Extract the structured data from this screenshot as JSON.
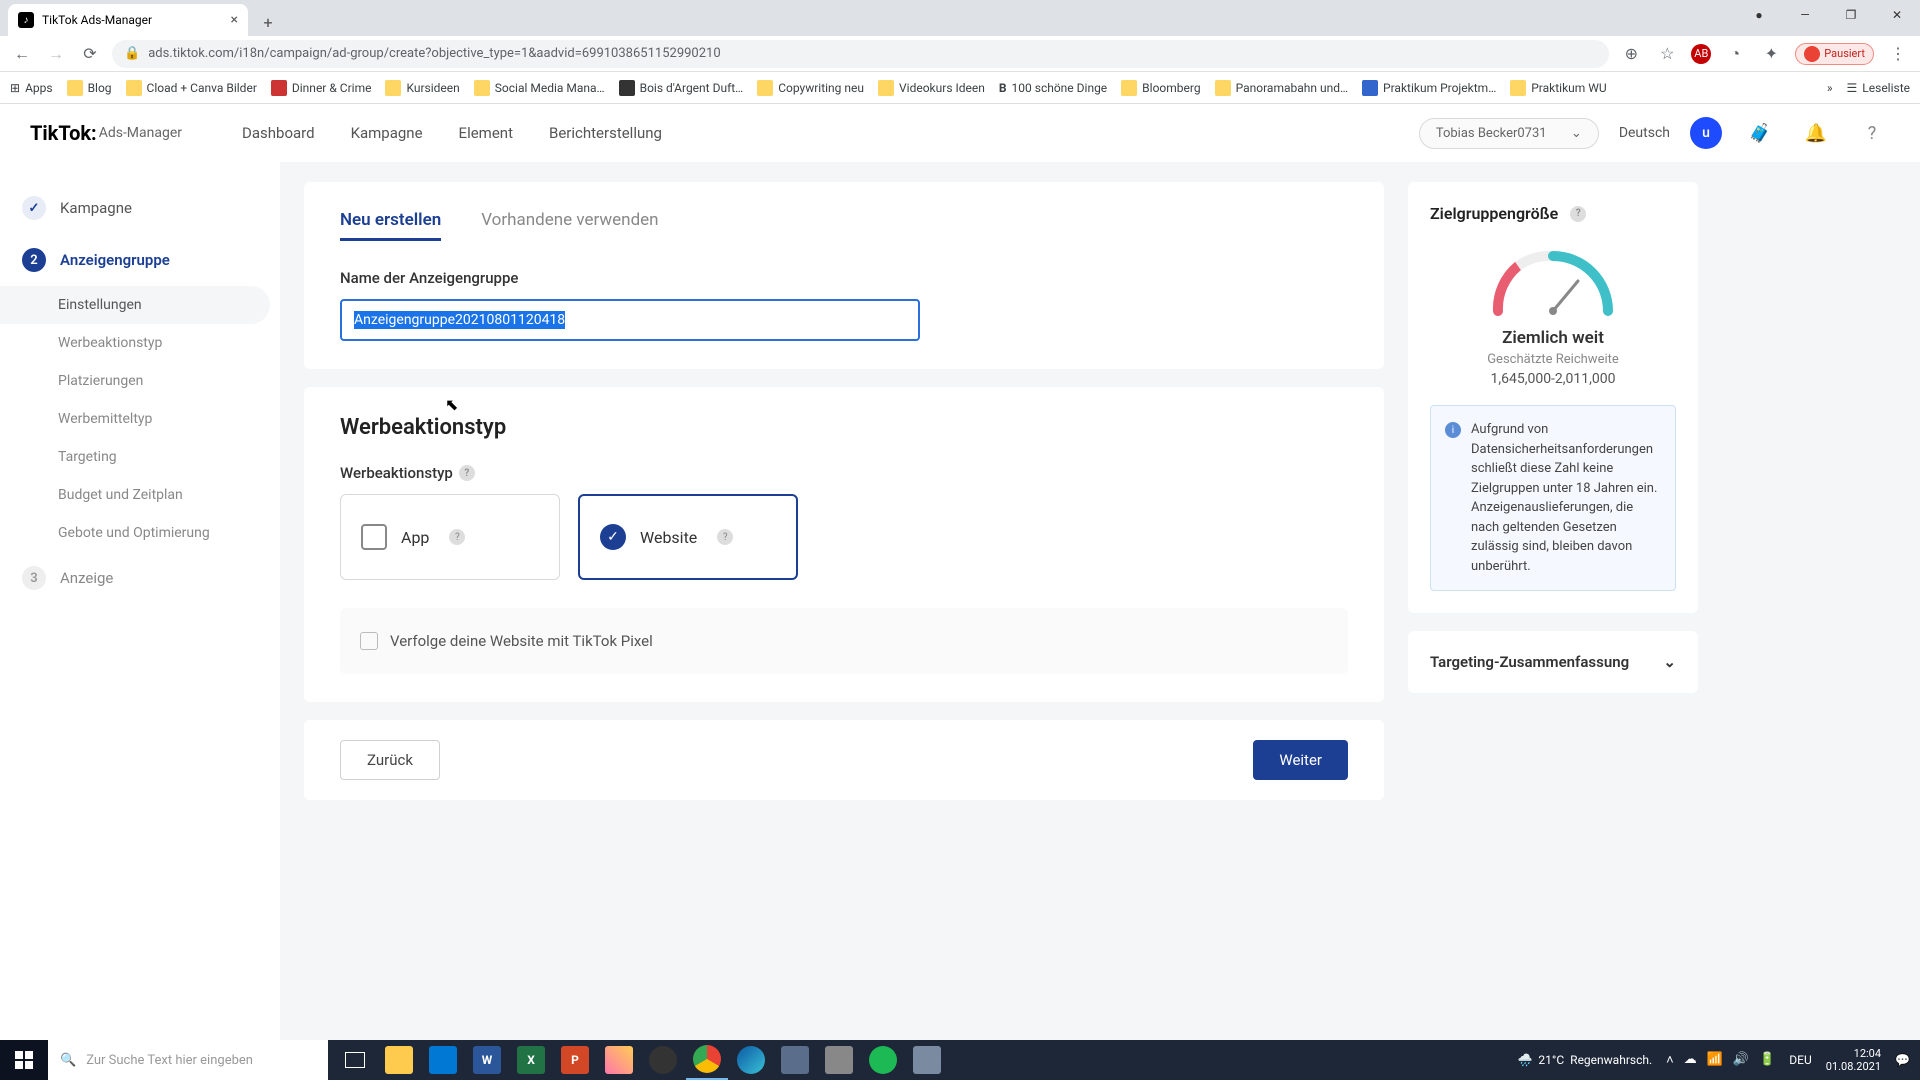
{
  "browser": {
    "tab_title": "TikTok Ads-Manager",
    "url": "ads.tiktok.com/i18n/campaign/ad-group/create?objective_type=1&aadvid=6991038651152990210",
    "pause_label": "Pausiert",
    "bookmarks": [
      "Apps",
      "Blog",
      "Cload + Canva Bilder",
      "Dinner & Crime",
      "Kursideen",
      "Social Media Mana…",
      "Bois d'Argent Duft…",
      "Copywriting neu",
      "Videokurs Ideen",
      "100 schöne Dinge",
      "Bloomberg",
      "Panoramabahn und…",
      "Praktikum Projektm…",
      "Praktikum WU"
    ],
    "reading_list": "Leseliste"
  },
  "header": {
    "logo_main": "TikTok:",
    "logo_sub": "Ads-Manager",
    "nav": [
      "Dashboard",
      "Kampagne",
      "Element",
      "Berichterstellung"
    ],
    "account": "Tobias Becker0731",
    "lang": "Deutsch",
    "avatar_letter": "u"
  },
  "sidebar": {
    "steps": [
      {
        "label": "Kampagne",
        "state": "done"
      },
      {
        "label": "Anzeigengruppe",
        "state": "active",
        "subs": [
          "Einstellungen",
          "Werbeaktionstyp",
          "Platzierungen",
          "Werbemitteltyp",
          "Targeting",
          "Budget und Zeitplan",
          "Gebote und Optimierung"
        ]
      },
      {
        "label": "Anzeige",
        "state": "pending",
        "num": "3"
      }
    ]
  },
  "main": {
    "tabs": {
      "new": "Neu erstellen",
      "existing": "Vorhandene verwenden"
    },
    "name_label": "Name der Anzeigengruppe",
    "name_value": "Anzeigengruppe20210801120418",
    "promo_section": "Werbeaktionstyp",
    "promo_label": "Werbeaktionstyp",
    "options": {
      "app": "App",
      "website": "Website"
    },
    "pixel_checkbox": "Verfolge deine Website mit TikTok Pixel",
    "back": "Zurück",
    "next": "Weiter"
  },
  "side": {
    "audience_title": "Zielgruppengröße",
    "gauge_label": "Ziemlich weit",
    "gauge_sub": "Geschätzte Reichweite",
    "gauge_range": "1,645,000-2,011,000",
    "info_text": "Aufgrund von Datensicherheitsanforderungen schließt diese Zahl keine Zielgruppen unter 18 Jahren ein. Anzeigenauslieferungen, die nach geltenden Gesetzen zulässig sind, bleiben davon unberührt.",
    "targeting_summary": "Targeting-Zusammenfassung"
  },
  "taskbar": {
    "search_placeholder": "Zur Suche Text hier eingeben",
    "weather_temp": "21°C",
    "weather_text": "Regenwahrsch.",
    "lang": "DEU",
    "time": "12:04",
    "date": "01.08.2021"
  }
}
